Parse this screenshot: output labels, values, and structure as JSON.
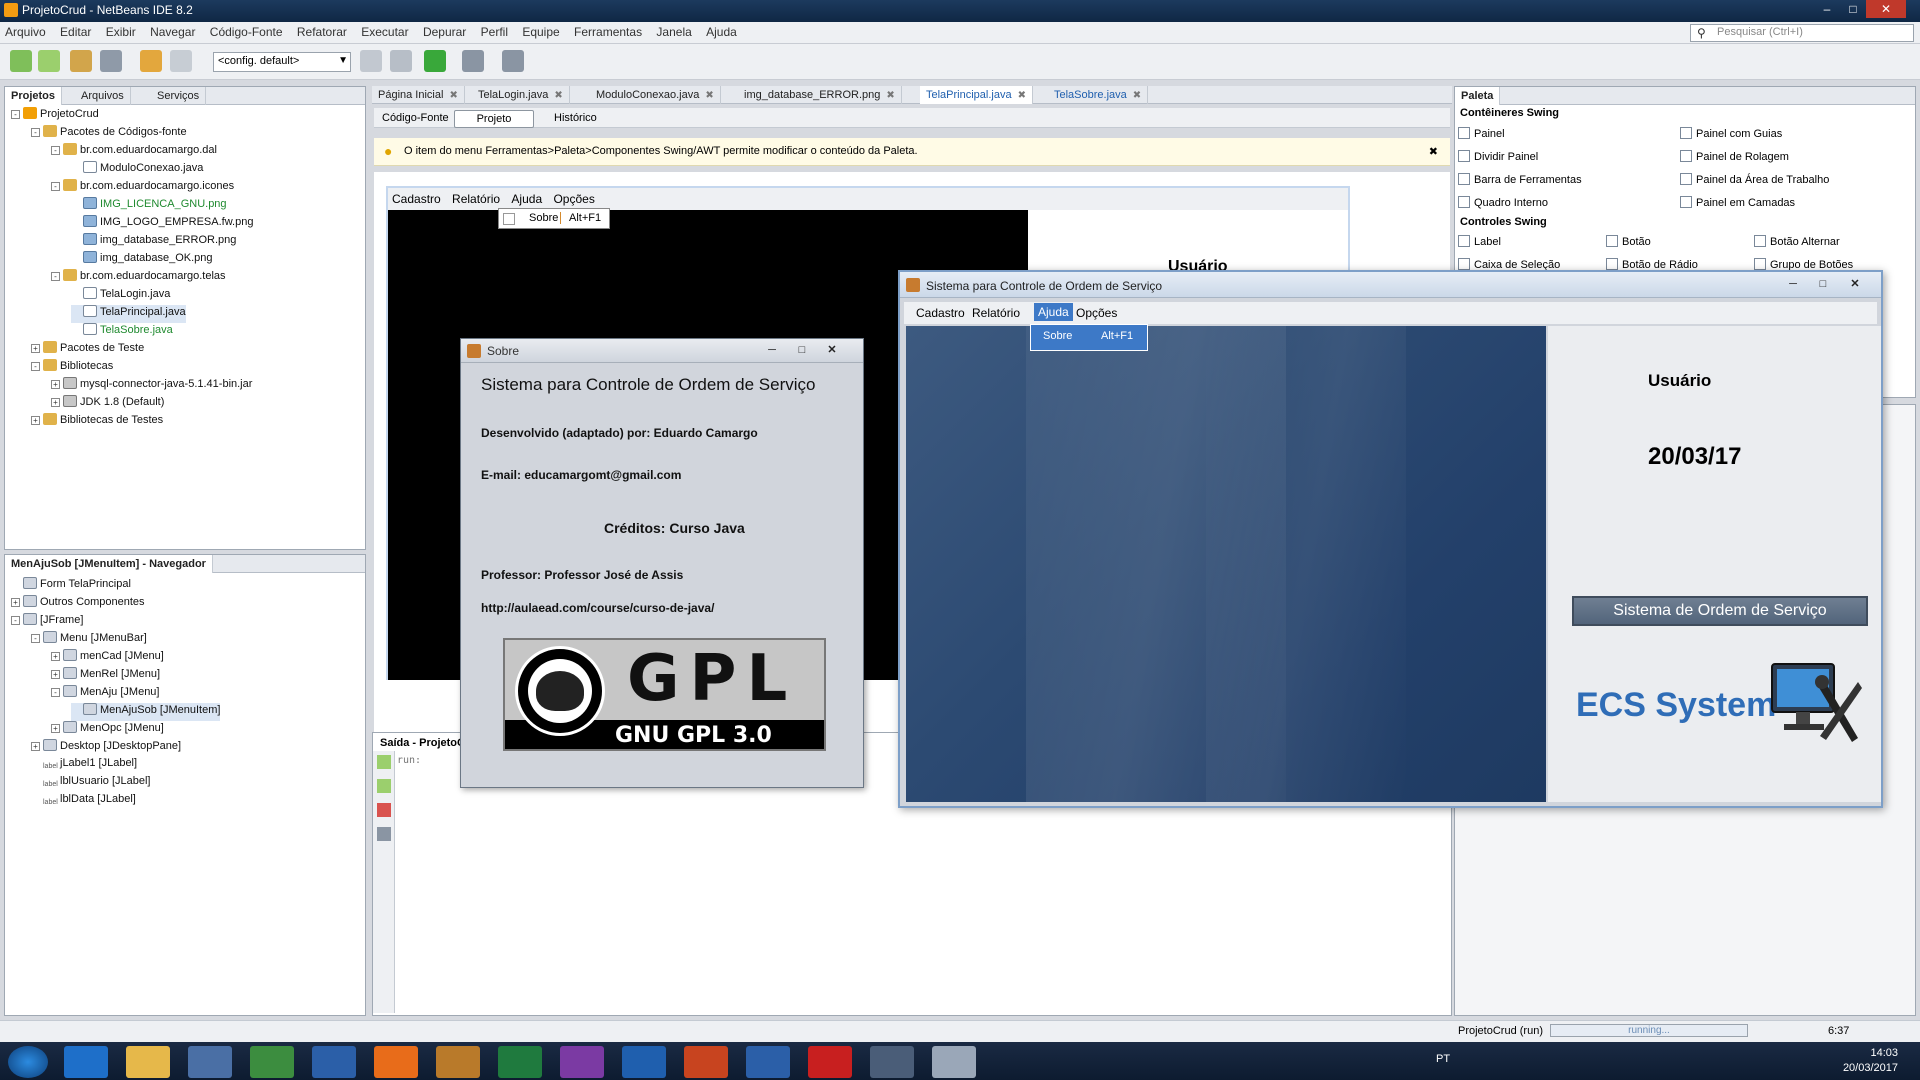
{
  "window": {
    "title": "ProjetoCrud - NetBeans IDE 8.2",
    "controls": [
      "–",
      "□",
      "✕"
    ]
  },
  "menubar": [
    "Arquivo",
    "Editar",
    "Exibir",
    "Navegar",
    "Código-Fonte",
    "Refatorar",
    "Executar",
    "Depurar",
    "Perfil",
    "Equipe",
    "Ferramentas",
    "Janela",
    "Ajuda"
  ],
  "search": {
    "placeholder": "Pesquisar (Ctrl+I)"
  },
  "toolbar": {
    "config": "<config. default>"
  },
  "projects_panel": {
    "tabs": [
      "Projetos",
      "Arquivos",
      "Serviços"
    ],
    "tree": [
      {
        "label": "ProjetoCrud",
        "indent": 0,
        "icon": "proj",
        "pm": "-"
      },
      {
        "label": "Pacotes de Códigos-fonte",
        "indent": 1,
        "icon": "pkg",
        "pm": "-"
      },
      {
        "label": "br.com.eduardocamargo.dal",
        "indent": 2,
        "icon": "pkg",
        "pm": "-"
      },
      {
        "label": "ModuloConexao.java",
        "indent": 3,
        "icon": "file",
        "pm": ""
      },
      {
        "label": "br.com.eduardocamargo.icones",
        "indent": 2,
        "icon": "pkg",
        "pm": "-"
      },
      {
        "label": "IMG_LICENCA_GNU.png",
        "indent": 3,
        "icon": "img",
        "pm": "",
        "green": true
      },
      {
        "label": "IMG_LOGO_EMPRESA.fw.png",
        "indent": 3,
        "icon": "img",
        "pm": ""
      },
      {
        "label": "img_database_ERROR.png",
        "indent": 3,
        "icon": "img",
        "pm": ""
      },
      {
        "label": "img_database_OK.png",
        "indent": 3,
        "icon": "img",
        "pm": ""
      },
      {
        "label": "br.com.eduardocamargo.telas",
        "indent": 2,
        "icon": "pkg",
        "pm": "-"
      },
      {
        "label": "TelaLogin.java",
        "indent": 3,
        "icon": "file",
        "pm": ""
      },
      {
        "label": "TelaPrincipal.java",
        "indent": 3,
        "icon": "file",
        "pm": "",
        "selected": true
      },
      {
        "label": "TelaSobre.java",
        "indent": 3,
        "icon": "file",
        "pm": "",
        "green": true
      },
      {
        "label": "Pacotes de Teste",
        "indent": 1,
        "icon": "pkg",
        "pm": "+"
      },
      {
        "label": "Bibliotecas",
        "indent": 1,
        "icon": "pkg",
        "pm": "-"
      },
      {
        "label": "mysql-connector-java-5.1.41-bin.jar",
        "indent": 2,
        "icon": "jar",
        "pm": "+"
      },
      {
        "label": "JDK 1.8 (Default)",
        "indent": 2,
        "icon": "jar",
        "pm": "+"
      },
      {
        "label": "Bibliotecas de Testes",
        "indent": 1,
        "icon": "pkg",
        "pm": "+"
      }
    ]
  },
  "navigator_panel": {
    "title": "MenAjuSob [JMenuItem] - Navegador",
    "tree": [
      {
        "label": "Form TelaPrincipal",
        "indent": 0,
        "icon": "comp",
        "pm": ""
      },
      {
        "label": "Outros Componentes",
        "indent": 0,
        "icon": "comp",
        "pm": "+"
      },
      {
        "label": "[JFrame]",
        "indent": 0,
        "icon": "comp",
        "pm": "-"
      },
      {
        "label": "Menu [JMenuBar]",
        "indent": 1,
        "icon": "comp",
        "pm": "-"
      },
      {
        "label": "menCad [JMenu]",
        "indent": 2,
        "icon": "comp",
        "pm": "+"
      },
      {
        "label": "MenRel [JMenu]",
        "indent": 2,
        "icon": "comp",
        "pm": "+"
      },
      {
        "label": "MenAju [JMenu]",
        "indent": 2,
        "icon": "comp",
        "pm": "-"
      },
      {
        "label": "MenAjuSob [JMenuItem]",
        "indent": 3,
        "icon": "comp",
        "pm": "",
        "selected": true
      },
      {
        "label": "MenOpc [JMenu]",
        "indent": 2,
        "icon": "comp",
        "pm": "+"
      },
      {
        "label": "Desktop [JDesktopPane]",
        "indent": 1,
        "icon": "comp",
        "pm": "+"
      },
      {
        "label": "jLabel1 [JLabel]",
        "indent": 1,
        "icon": "lbl",
        "pm": ""
      },
      {
        "label": "lblUsuario [JLabel]",
        "indent": 1,
        "icon": "lbl",
        "pm": ""
      },
      {
        "label": "lblData [JLabel]",
        "indent": 1,
        "icon": "lbl",
        "pm": ""
      }
    ]
  },
  "editor": {
    "tabs": [
      "Página Inicial",
      "TelaLogin.java",
      "ModuloConexao.java",
      "img_database_ERROR.png",
      "TelaPrincipal.java",
      "TelaSobre.java"
    ],
    "subtabs": [
      "Código-Fonte",
      "Projeto",
      "Histórico"
    ],
    "info": "O item do menu Ferramentas>Paleta>Componentes Swing/AWT permite modificar o conteúdo da Paleta.",
    "design_menu": [
      "Cadastro",
      "Relatório",
      "Ajuda",
      "Opções"
    ],
    "design_sobre": "Sobre",
    "design_shortcut": "Alt+F1",
    "design_usuario": "Usuário"
  },
  "palette": {
    "title": "Paleta",
    "sections": [
      {
        "name": "Contêineres Swing",
        "items": [
          "Painel",
          "Painel com Guias",
          "Dividir Painel",
          "Painel de Rolagem",
          "Barra de Ferramentas",
          "Painel da Área de Trabalho",
          "Quadro Interno",
          "Painel em Camadas"
        ]
      },
      {
        "name": "Controles Swing",
        "items": [
          "Label",
          "Botão",
          "Botão Alternar",
          "Caixa de Seleção",
          "Botão de Rádio",
          "Grupo de Botões"
        ]
      }
    ]
  },
  "output": {
    "title": "Saída - ProjetoC",
    "text": "run:"
  },
  "sobre_dialog": {
    "title": "Sobre",
    "heading": "Sistema para Controle de Ordem de Serviço",
    "developer": "Desenvolvido (adaptado) por: Eduardo Camargo",
    "email": "E-mail: educamargomt@gmail.com",
    "credits": "Créditos: Curso Java",
    "professor": "Professor: Professor José de Assis",
    "url": "http://aulaead.com/course/curso-de-java/",
    "gpl_big": "GPL",
    "gpl_small": "GNU GPL 3.0"
  },
  "main_app": {
    "title": "Sistema para Controle de Ordem de Serviço",
    "menu": [
      "Cadastro",
      "Relatório",
      "Ajuda",
      "Opções"
    ],
    "dropdown_item": "Sobre",
    "dropdown_shortcut": "Alt+F1",
    "usuario": "Usuário",
    "date": "20/03/17",
    "button": "Sistema de Ordem de Serviço",
    "logo": "ECS System"
  },
  "statusbar": {
    "project": "ProjetoCrud (run)",
    "progress": "running...",
    "position": "6:37"
  },
  "taskbar": {
    "lang": "PT",
    "time": "14:03",
    "date": "20/03/2017"
  },
  "colors": {
    "accent": "#3d79c7",
    "green_text": "#1f8a2f",
    "ecs_blue": "#2f6db7"
  }
}
